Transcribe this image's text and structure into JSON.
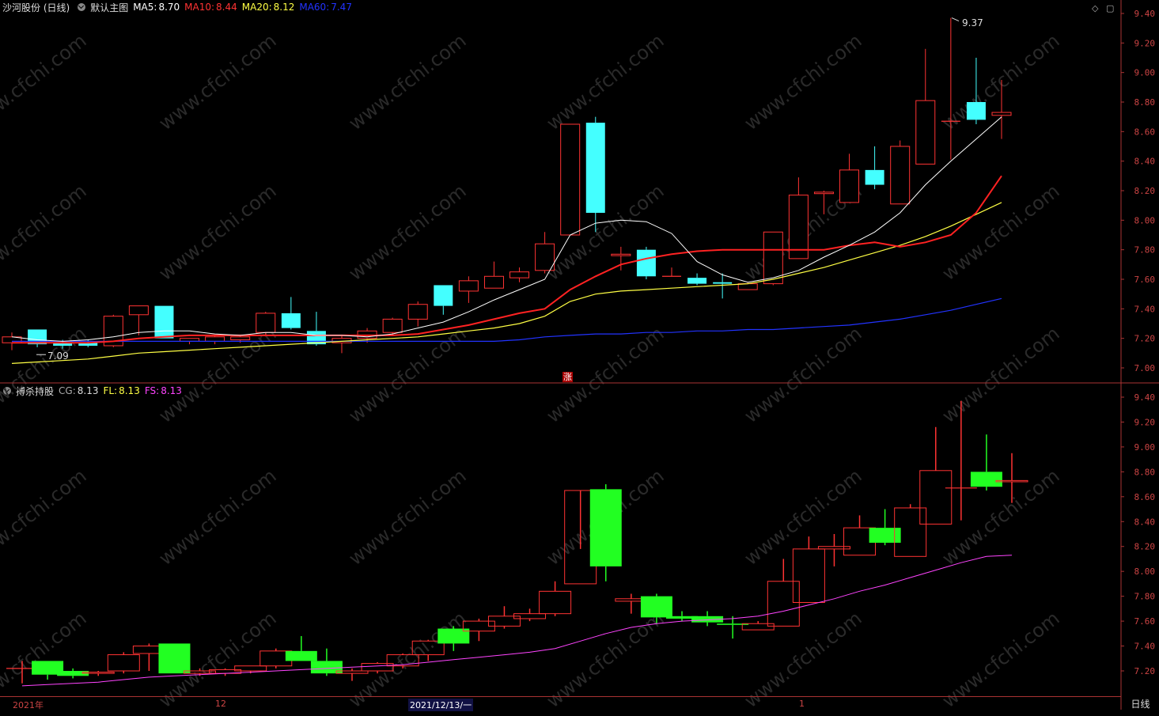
{
  "main_panel": {
    "stock_name": "沙河股份 (日线)",
    "indicator_name": "默认主图",
    "ma5": {
      "label": "MA5:",
      "value": "8.70",
      "color": "#ffffff"
    },
    "ma10": {
      "label": "MA10:",
      "value": "8.44",
      "color": "#ff2222"
    },
    "ma20": {
      "label": "MA20:",
      "value": "8.12",
      "color": "#ffff44"
    },
    "ma60": {
      "label": "MA60:",
      "value": "7.47",
      "color": "#2233ff"
    },
    "y_ticks": [
      "9.40",
      "9.20",
      "9.00",
      "8.80",
      "8.60",
      "8.40",
      "8.20",
      "8.00",
      "7.80",
      "7.60",
      "7.40",
      "7.20",
      "7.00"
    ],
    "high_mark": "9.37",
    "low_mark": "7.09",
    "zhang_badge": "涨"
  },
  "sub_panel": {
    "indicator_name": "搏杀持股",
    "cg": {
      "label": "CG:",
      "value": "8.13",
      "color": "#ffffff"
    },
    "fl": {
      "label": "FL:",
      "value": "8.13",
      "color": "#ffff44"
    },
    "fs": {
      "label": "FS:",
      "value": "8.13",
      "color": "#ff44ff"
    },
    "y_ticks": [
      "9.40",
      "9.20",
      "9.00",
      "8.80",
      "8.60",
      "8.40",
      "8.20",
      "8.00",
      "7.80",
      "7.60",
      "7.40",
      "7.20"
    ]
  },
  "time_axis": {
    "labels": [
      "2021年",
      "12",
      "2021/12/13/一",
      "1"
    ]
  },
  "period_label": "日线",
  "watermark": "www.cfchi.com",
  "chart_data": {
    "type": "candlestick",
    "ylim": [
      6.95,
      9.45
    ],
    "candles": [
      {
        "o": 7.17,
        "h": 7.24,
        "l": 7.12,
        "c": 7.21
      },
      {
        "o": 7.26,
        "h": 7.26,
        "l": 7.14,
        "c": 7.16
      },
      {
        "o": 7.17,
        "h": 7.19,
        "l": 7.13,
        "c": 7.15
      },
      {
        "o": 7.17,
        "h": 7.19,
        "l": 7.14,
        "c": 7.15
      },
      {
        "o": 7.15,
        "h": 7.36,
        "l": 7.14,
        "c": 7.35
      },
      {
        "o": 7.36,
        "h": 7.42,
        "l": 7.22,
        "c": 7.42
      },
      {
        "o": 7.42,
        "h": 7.42,
        "l": 7.2,
        "c": 7.2
      },
      {
        "o": 7.18,
        "h": 7.2,
        "l": 7.16,
        "c": 7.2
      },
      {
        "o": 7.18,
        "h": 7.22,
        "l": 7.16,
        "c": 7.21
      },
      {
        "o": 7.19,
        "h": 7.22,
        "l": 7.17,
        "c": 7.21
      },
      {
        "o": 7.24,
        "h": 7.38,
        "l": 7.22,
        "c": 7.37
      },
      {
        "o": 7.37,
        "h": 7.48,
        "l": 7.26,
        "c": 7.27
      },
      {
        "o": 7.25,
        "h": 7.38,
        "l": 7.15,
        "c": 7.16
      },
      {
        "o": 7.17,
        "h": 7.22,
        "l": 7.1,
        "c": 7.2
      },
      {
        "o": 7.2,
        "h": 7.27,
        "l": 7.17,
        "c": 7.25
      },
      {
        "o": 7.24,
        "h": 7.34,
        "l": 7.22,
        "c": 7.33
      },
      {
        "o": 7.33,
        "h": 7.45,
        "l": 7.28,
        "c": 7.43
      },
      {
        "o": 7.56,
        "h": 7.56,
        "l": 7.36,
        "c": 7.42
      },
      {
        "o": 7.52,
        "h": 7.62,
        "l": 7.44,
        "c": 7.59
      },
      {
        "o": 7.54,
        "h": 7.72,
        "l": 7.54,
        "c": 7.62
      },
      {
        "o": 7.61,
        "h": 7.68,
        "l": 7.58,
        "c": 7.65
      },
      {
        "o": 7.66,
        "h": 7.92,
        "l": 7.64,
        "c": 7.84
      },
      {
        "o": 7.9,
        "h": 8.17,
        "l": 7.9,
        "c": 8.65
      },
      {
        "o": 8.66,
        "h": 8.7,
        "l": 7.92,
        "c": 8.05
      },
      {
        "o": 7.76,
        "h": 7.82,
        "l": 7.66,
        "c": 7.77
      },
      {
        "o": 7.8,
        "h": 7.82,
        "l": 7.6,
        "c": 7.62
      },
      {
        "o": 7.62,
        "h": 7.68,
        "l": 7.62,
        "c": 7.62
      },
      {
        "o": 7.61,
        "h": 7.64,
        "l": 7.56,
        "c": 7.57
      },
      {
        "o": 7.58,
        "h": 7.64,
        "l": 7.47,
        "c": 7.57
      },
      {
        "o": 7.53,
        "h": 7.58,
        "l": 7.53,
        "c": 7.57
      },
      {
        "o": 7.57,
        "h": 7.9,
        "l": 7.56,
        "c": 7.92
      },
      {
        "o": 7.74,
        "h": 8.29,
        "l": 7.74,
        "c": 8.17
      },
      {
        "o": 8.18,
        "h": 8.2,
        "l": 8.04,
        "c": 8.19
      },
      {
        "o": 8.12,
        "h": 8.45,
        "l": 8.12,
        "c": 8.34
      },
      {
        "o": 8.34,
        "h": 8.5,
        "l": 8.21,
        "c": 8.24
      },
      {
        "o": 8.11,
        "h": 8.54,
        "l": 8.11,
        "c": 8.5
      },
      {
        "o": 8.38,
        "h": 9.16,
        "l": 8.38,
        "c": 8.81
      },
      {
        "o": 8.67,
        "h": 9.37,
        "l": 8.41,
        "c": 8.67
      },
      {
        "o": 8.8,
        "h": 9.1,
        "l": 8.65,
        "c": 8.68
      },
      {
        "o": 8.71,
        "h": 8.95,
        "l": 8.55,
        "c": 8.73
      }
    ],
    "ma5": [
      7.21,
      7.19,
      7.18,
      7.19,
      7.21,
      7.24,
      7.25,
      7.25,
      7.23,
      7.22,
      7.24,
      7.24,
      7.22,
      7.22,
      7.21,
      7.23,
      7.27,
      7.31,
      7.38,
      7.46,
      7.53,
      7.6,
      7.9,
      7.98,
      8.0,
      7.99,
      7.91,
      7.72,
      7.63,
      7.58,
      7.61,
      7.66,
      7.75,
      7.83,
      7.92,
      8.05,
      8.24,
      8.4,
      8.55,
      8.7
    ],
    "ma10": [
      7.17,
      7.17,
      7.17,
      7.17,
      7.18,
      7.2,
      7.21,
      7.22,
      7.22,
      7.22,
      7.22,
      7.22,
      7.22,
      7.22,
      7.22,
      7.22,
      7.23,
      7.26,
      7.29,
      7.33,
      7.37,
      7.4,
      7.53,
      7.62,
      7.7,
      7.74,
      7.77,
      7.79,
      7.8,
      7.8,
      7.8,
      7.8,
      7.8,
      7.83,
      7.85,
      7.82,
      7.85,
      7.9,
      8.05,
      8.3
    ],
    "ma20": [
      7.03,
      7.04,
      7.05,
      7.06,
      7.08,
      7.1,
      7.11,
      7.12,
      7.13,
      7.14,
      7.15,
      7.16,
      7.17,
      7.18,
      7.19,
      7.2,
      7.21,
      7.23,
      7.25,
      7.27,
      7.3,
      7.35,
      7.45,
      7.5,
      7.52,
      7.53,
      7.54,
      7.55,
      7.56,
      7.57,
      7.6,
      7.64,
      7.68,
      7.73,
      7.78,
      7.83,
      7.89,
      7.96,
      8.04,
      8.12
    ],
    "ma60": [
      7.18,
      7.18,
      7.18,
      7.18,
      7.18,
      7.18,
      7.18,
      7.18,
      7.18,
      7.18,
      7.18,
      7.18,
      7.18,
      7.18,
      7.18,
      7.18,
      7.18,
      7.18,
      7.18,
      7.18,
      7.19,
      7.21,
      7.22,
      7.23,
      7.23,
      7.24,
      7.24,
      7.25,
      7.25,
      7.26,
      7.26,
      7.27,
      7.28,
      7.29,
      7.31,
      7.33,
      7.36,
      7.39,
      7.43,
      7.47
    ],
    "sub_ylim": [
      7.1,
      9.5
    ],
    "sub_candles": [
      {
        "o": 7.22,
        "h": 7.28,
        "l": 7.1,
        "c": 7.22
      },
      {
        "o": 7.28,
        "h": 7.28,
        "l": 7.13,
        "c": 7.17
      },
      {
        "o": 7.2,
        "h": 7.22,
        "l": 7.14,
        "c": 7.16
      },
      {
        "o": 7.18,
        "h": 7.2,
        "l": 7.16,
        "c": 7.19
      },
      {
        "o": 7.2,
        "h": 7.35,
        "l": 7.18,
        "c": 7.33
      },
      {
        "o": 7.34,
        "h": 7.42,
        "l": 7.2,
        "c": 7.4
      },
      {
        "o": 7.42,
        "h": 7.42,
        "l": 7.18,
        "c": 7.18
      },
      {
        "o": 7.18,
        "h": 7.22,
        "l": 7.16,
        "c": 7.2
      },
      {
        "o": 7.18,
        "h": 7.22,
        "l": 7.16,
        "c": 7.21
      },
      {
        "o": 7.2,
        "h": 7.24,
        "l": 7.18,
        "c": 7.24
      },
      {
        "o": 7.24,
        "h": 7.38,
        "l": 7.22,
        "c": 7.36
      },
      {
        "o": 7.36,
        "h": 7.48,
        "l": 7.28,
        "c": 7.28
      },
      {
        "o": 7.28,
        "h": 7.38,
        "l": 7.16,
        "c": 7.18
      },
      {
        "o": 7.18,
        "h": 7.22,
        "l": 7.12,
        "c": 7.2
      },
      {
        "o": 7.2,
        "h": 7.27,
        "l": 7.18,
        "c": 7.26
      },
      {
        "o": 7.24,
        "h": 7.34,
        "l": 7.22,
        "c": 7.33
      },
      {
        "o": 7.33,
        "h": 7.45,
        "l": 7.28,
        "c": 7.44
      },
      {
        "o": 7.54,
        "h": 7.56,
        "l": 7.36,
        "c": 7.42
      },
      {
        "o": 7.52,
        "h": 7.62,
        "l": 7.44,
        "c": 7.6
      },
      {
        "o": 7.56,
        "h": 7.72,
        "l": 7.54,
        "c": 7.64
      },
      {
        "o": 7.62,
        "h": 7.7,
        "l": 7.6,
        "c": 7.66
      },
      {
        "o": 7.66,
        "h": 7.92,
        "l": 7.64,
        "c": 7.84
      },
      {
        "o": 7.9,
        "h": 8.18,
        "l": 7.9,
        "c": 8.65
      },
      {
        "o": 8.66,
        "h": 8.7,
        "l": 7.92,
        "c": 8.04
      },
      {
        "o": 7.76,
        "h": 7.82,
        "l": 7.66,
        "c": 7.78
      },
      {
        "o": 7.8,
        "h": 7.82,
        "l": 7.58,
        "c": 7.63
      },
      {
        "o": 7.64,
        "h": 7.68,
        "l": 7.6,
        "c": 7.62
      },
      {
        "o": 7.64,
        "h": 7.68,
        "l": 7.56,
        "c": 7.59
      },
      {
        "o": 7.58,
        "h": 7.64,
        "l": 7.46,
        "c": 7.57
      },
      {
        "o": 7.53,
        "h": 7.6,
        "l": 7.53,
        "c": 7.58
      },
      {
        "o": 7.56,
        "h": 8.1,
        "l": 7.56,
        "c": 7.92
      },
      {
        "o": 7.75,
        "h": 8.28,
        "l": 7.75,
        "c": 8.18
      },
      {
        "o": 8.18,
        "h": 8.3,
        "l": 8.04,
        "c": 8.2
      },
      {
        "o": 8.13,
        "h": 8.45,
        "l": 8.13,
        "c": 8.35
      },
      {
        "o": 8.35,
        "h": 8.5,
        "l": 8.21,
        "c": 8.23
      },
      {
        "o": 8.12,
        "h": 8.54,
        "l": 8.12,
        "c": 8.51
      },
      {
        "o": 8.38,
        "h": 9.16,
        "l": 8.38,
        "c": 8.81
      },
      {
        "o": 8.67,
        "h": 9.37,
        "l": 8.41,
        "c": 8.67
      },
      {
        "o": 8.8,
        "h": 9.1,
        "l": 8.65,
        "c": 8.68
      },
      {
        "o": 8.72,
        "h": 8.95,
        "l": 8.55,
        "c": 8.73
      }
    ],
    "fs_line": [
      7.08,
      7.09,
      7.1,
      7.11,
      7.13,
      7.15,
      7.16,
      7.17,
      7.18,
      7.19,
      7.2,
      7.21,
      7.22,
      7.23,
      7.24,
      7.25,
      7.27,
      7.29,
      7.31,
      7.33,
      7.35,
      7.38,
      7.44,
      7.5,
      7.55,
      7.58,
      7.6,
      7.61,
      7.62,
      7.64,
      7.68,
      7.73,
      7.78,
      7.84,
      7.89,
      7.95,
      8.01,
      8.07,
      8.12,
      8.13
    ]
  }
}
